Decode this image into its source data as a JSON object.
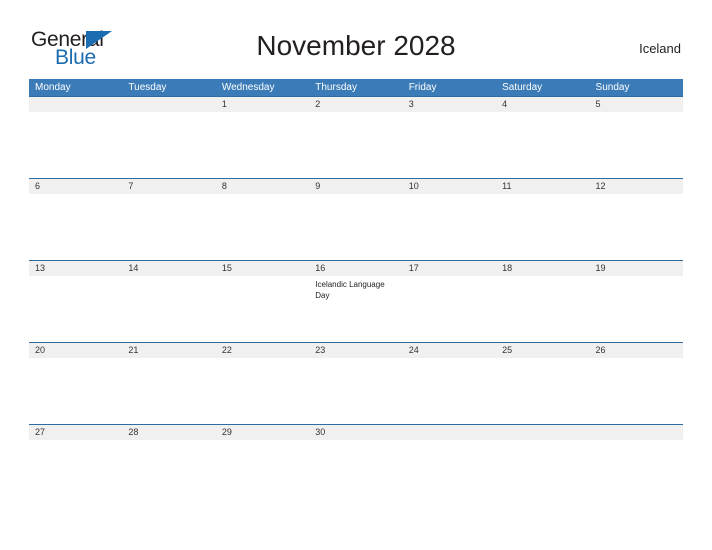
{
  "brand": {
    "name_part1": "General",
    "name_part2": "Blue",
    "triangle_icon": "triangle-icon",
    "color_primary": "#1b6cb0",
    "color_text": "#231f20"
  },
  "header": {
    "title": "November 2028",
    "country": "Iceland"
  },
  "theme": {
    "header_bg": "#3b7cb8",
    "header_text": "#ffffff",
    "date_row_bg": "#f0f0f0",
    "row_divider": "#2e6da4",
    "page_bg": "#ffffff"
  },
  "calendar": {
    "weekdays": [
      "Monday",
      "Tuesday",
      "Wednesday",
      "Thursday",
      "Friday",
      "Saturday",
      "Sunday"
    ],
    "weeks": [
      {
        "days": [
          {
            "date": "",
            "events": []
          },
          {
            "date": "",
            "events": []
          },
          {
            "date": "1",
            "events": []
          },
          {
            "date": "2",
            "events": []
          },
          {
            "date": "3",
            "events": []
          },
          {
            "date": "4",
            "events": []
          },
          {
            "date": "5",
            "events": []
          }
        ]
      },
      {
        "days": [
          {
            "date": "6",
            "events": []
          },
          {
            "date": "7",
            "events": []
          },
          {
            "date": "8",
            "events": []
          },
          {
            "date": "9",
            "events": []
          },
          {
            "date": "10",
            "events": []
          },
          {
            "date": "11",
            "events": []
          },
          {
            "date": "12",
            "events": []
          }
        ]
      },
      {
        "days": [
          {
            "date": "13",
            "events": []
          },
          {
            "date": "14",
            "events": []
          },
          {
            "date": "15",
            "events": []
          },
          {
            "date": "16",
            "events": [
              "Icelandic Language Day"
            ]
          },
          {
            "date": "17",
            "events": []
          },
          {
            "date": "18",
            "events": []
          },
          {
            "date": "19",
            "events": []
          }
        ]
      },
      {
        "days": [
          {
            "date": "20",
            "events": []
          },
          {
            "date": "21",
            "events": []
          },
          {
            "date": "22",
            "events": []
          },
          {
            "date": "23",
            "events": []
          },
          {
            "date": "24",
            "events": []
          },
          {
            "date": "25",
            "events": []
          },
          {
            "date": "26",
            "events": []
          }
        ]
      },
      {
        "days": [
          {
            "date": "27",
            "events": []
          },
          {
            "date": "28",
            "events": []
          },
          {
            "date": "29",
            "events": []
          },
          {
            "date": "30",
            "events": []
          },
          {
            "date": "",
            "events": []
          },
          {
            "date": "",
            "events": []
          },
          {
            "date": "",
            "events": []
          }
        ]
      }
    ]
  }
}
